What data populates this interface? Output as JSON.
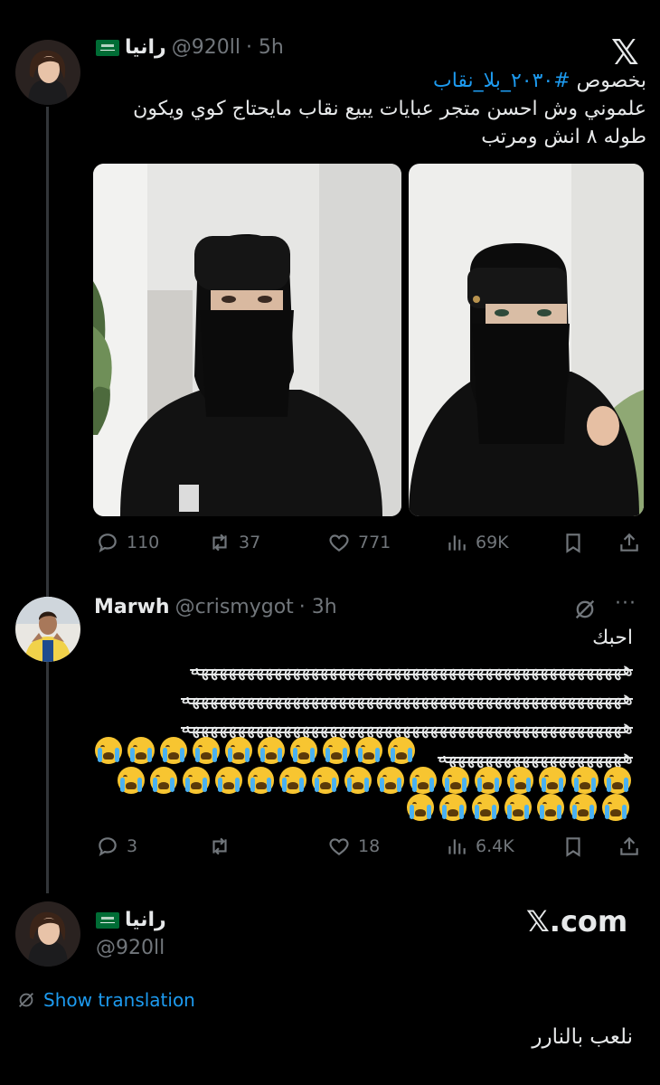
{
  "tweet1": {
    "display_name": "رانيا",
    "handle": "@920ll",
    "time": "· 5h",
    "hashtag": "#٢٠٣٠_بلا_نقاب",
    "text_prefix": "بخصوص ",
    "line2": "علموني وش احسن متجر عبايات يبيع نقاب مايحتاج كوي ويكون",
    "line3": "طوله ٨ انش ومرتب",
    "replies": "110",
    "retweets": "37",
    "likes": "771",
    "views": "69K"
  },
  "tweet2": {
    "display_name": "Marwh",
    "handle": "@crismygot",
    "time": "· 3h",
    "more": "···",
    "text_first": "احبك",
    "garbled1": "هههههههههههههههههههههههههههههههههههههههههههههههه",
    "garbled2": "ههههههههههههههههههههههههههههههههههههههههههههههههه",
    "garbled3": "ههههههههههههههههههههههههههههههههههههههههههههههههه",
    "garbled4": "ههههههههههههههههههههه",
    "emoji_row1_count": 10,
    "emoji_row2_count": 16,
    "emoji_row3_count": 7,
    "replies": "3",
    "retweets": "",
    "likes": "18",
    "views": "6.4K"
  },
  "tweet3": {
    "display_name": "رانيا",
    "handle": "@920ll",
    "site": "𝕏.com",
    "show_translation": "Show translation",
    "text": "نلعب بالنارر"
  },
  "brand": {
    "x_logo": "𝕏"
  },
  "colors": {
    "background": "#000000",
    "text": "#e7e9ea",
    "muted": "#71767b",
    "link": "#1d9bf0",
    "thread_line": "#333639"
  }
}
